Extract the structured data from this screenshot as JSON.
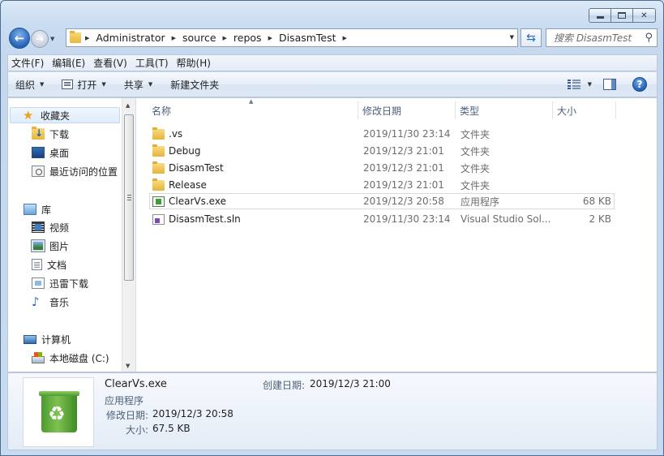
{
  "window": {
    "caption_buttons": [
      "minimize",
      "maximize",
      "close"
    ]
  },
  "address": {
    "crumbs": [
      "Administrator",
      "source",
      "repos",
      "DisasmTest"
    ]
  },
  "search": {
    "placeholder": "搜索 DisasmTest"
  },
  "menu": {
    "items": [
      "文件(F)",
      "编辑(E)",
      "查看(V)",
      "工具(T)",
      "帮助(H)"
    ]
  },
  "commands": {
    "organize": "组织",
    "open": "打开",
    "share": "共享",
    "new_folder": "新建文件夹"
  },
  "nav": {
    "favorites": "收藏夹",
    "downloads": "下载",
    "desktop": "桌面",
    "recent": "最近访问的位置",
    "libraries": "库",
    "videos": "视频",
    "pictures": "图片",
    "documents": "文档",
    "thunder": "迅雷下载",
    "music": "音乐",
    "computer": "计算机",
    "local_disk": "本地磁盘 (C:)"
  },
  "columns": {
    "name": "名称",
    "date": "修改日期",
    "type": "类型",
    "size": "大小"
  },
  "files": [
    {
      "name": ".vs",
      "date": "2019/11/30 23:14",
      "type": "文件夹",
      "size": "",
      "icon": "folder-icon"
    },
    {
      "name": "Debug",
      "date": "2019/12/3 21:01",
      "type": "文件夹",
      "size": "",
      "icon": "folder-icon"
    },
    {
      "name": "DisasmTest",
      "date": "2019/12/3 21:01",
      "type": "文件夹",
      "size": "",
      "icon": "folder-icon"
    },
    {
      "name": "Release",
      "date": "2019/12/3 21:01",
      "type": "文件夹",
      "size": "",
      "icon": "folder-icon"
    },
    {
      "name": "ClearVs.exe",
      "date": "2019/12/3 20:58",
      "type": "应用程序",
      "size": "68 KB",
      "icon": "exe-icon",
      "selected": true
    },
    {
      "name": "DisasmTest.sln",
      "date": "2019/11/30 23:14",
      "type": "Visual Studio Sol...",
      "size": "2 KB",
      "icon": "sln-icon"
    }
  ],
  "details": {
    "name": "ClearVs.exe",
    "type": "应用程序",
    "modified_label": "修改日期:",
    "modified": "2019/12/3 20:58",
    "size_label": "大小:",
    "size": "67.5 KB",
    "created_label": "创建日期:",
    "created": "2019/12/3 21:00"
  }
}
